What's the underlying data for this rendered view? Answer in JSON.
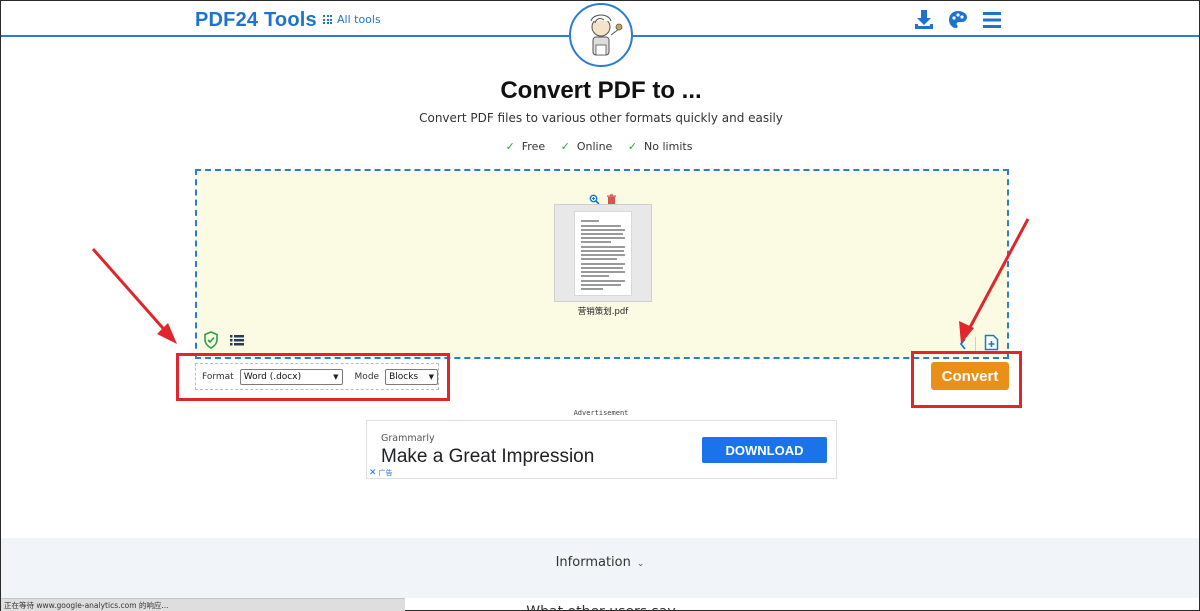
{
  "header": {
    "brand": "PDF24 Tools",
    "all_tools": "All tools",
    "icons": [
      "grid-icon",
      "download-icon",
      "palette-icon",
      "menu-icon"
    ]
  },
  "hero": {
    "title": "Convert PDF to ...",
    "subtitle": "Convert PDF files to various other formats quickly and easily",
    "features": [
      "Free",
      "Online",
      "No limits"
    ]
  },
  "dropzone": {
    "file": {
      "name": "营销策划.pdf"
    },
    "icons": [
      "zoom-icon",
      "trash-icon",
      "shield-check-icon",
      "list-icon",
      "chevron-left-icon",
      "add-file-icon"
    ]
  },
  "options": {
    "format_label": "Format",
    "format_value": "Word (.docx)",
    "mode_label": "Mode",
    "mode_value": "Blocks"
  },
  "convert_label": "Convert",
  "ad": {
    "label": "Advertisement",
    "brand": "Grammarly",
    "headline": "Make a Great Impression",
    "button": "DOWNLOAD",
    "corner_label": "广告"
  },
  "info": {
    "toggle_label": "Information",
    "next_heading": "What other users say"
  },
  "status_text": "正在等待 www.google-analytics.com 的响应...",
  "colors": {
    "brand_blue": "#1e73cf",
    "convert_orange": "#ea8f19",
    "annotation_red": "#e0252b",
    "dropzone_bg": "#fbfbe3"
  }
}
